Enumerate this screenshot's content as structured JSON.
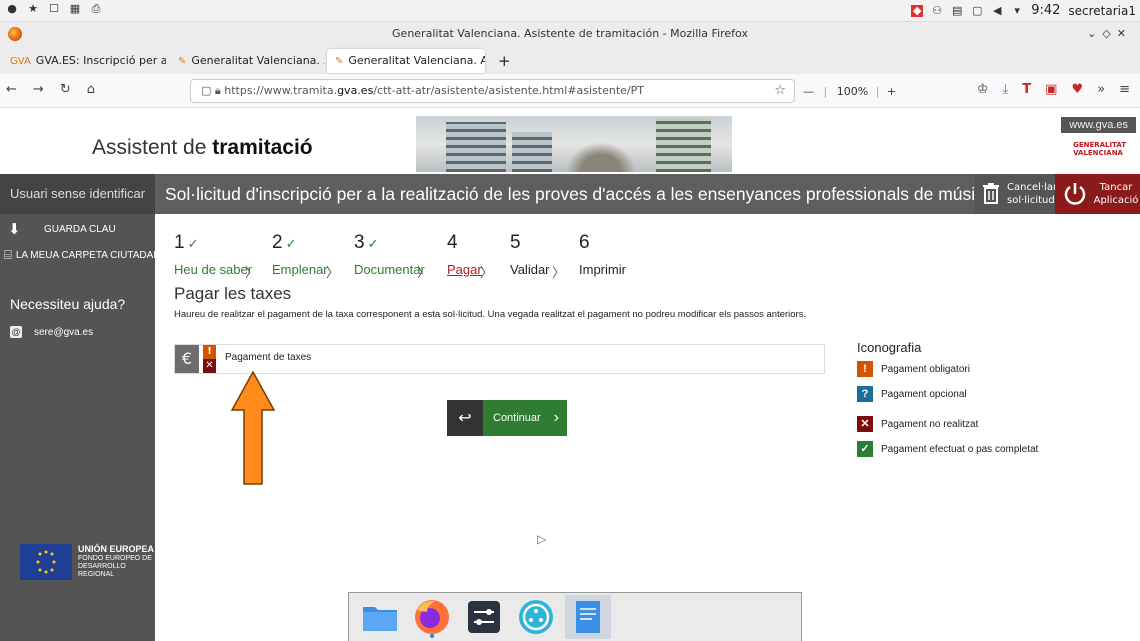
{
  "os": {
    "clock": "9:42",
    "user": "secretaria1"
  },
  "window": {
    "title": "Generalitat Valenciana. Asistente de tramitación - Mozilla Firefox"
  },
  "tabs": [
    {
      "label": "GVA.ES: Inscripció per a la",
      "fav": "GVA"
    },
    {
      "label": "Generalitat Valenciana. Asi"
    },
    {
      "label": "Generalitat Valenciana. Asi"
    }
  ],
  "nav": {
    "url_pre": "https://www.tramita.",
    "url_bold": "gva.es",
    "url_post": "/ctt-att-atr/asistente/asistente.html#asistente/PT",
    "zoom": "100%"
  },
  "site": {
    "brand_pre": "Assistent de ",
    "brand_bold": "tramitació",
    "gva_url": "www.gva.es",
    "logo_line1": "GENERALITAT",
    "logo_line2": "VALENCIANA"
  },
  "titlebar": {
    "user": "Usuari sense identificar",
    "page_title": "Sol·licitud d'inscripció per a la realització de les proves d'accés a les ensenyances professionals de música i dansa",
    "cancel_line1": "Cancel·lar",
    "cancel_line2": "sol·licitud",
    "close_line1": "Tancar",
    "close_line2": "Aplicació"
  },
  "sidebar": {
    "save_key": "GUARDA CLAU",
    "folder": "LA MEUA CARPETA CIUTADANA",
    "help": "Necessiteu ajuda?",
    "email": "sere@gva.es",
    "eu_title": "UNIÓN EUROPEA",
    "eu_line1": "FONDO EUROPEO DE",
    "eu_line2": "DESARROLLO REGIONAL"
  },
  "steps": [
    {
      "num": "1",
      "label": "Heu de saber",
      "state": "done"
    },
    {
      "num": "2",
      "label": "Emplenar",
      "state": "done"
    },
    {
      "num": "3",
      "label": "Documentar",
      "state": "done"
    },
    {
      "num": "4",
      "label": "Pagar",
      "state": "current"
    },
    {
      "num": "5",
      "label": "Validar",
      "state": "todo"
    },
    {
      "num": "6",
      "label": "Imprimir",
      "state": "todo"
    }
  ],
  "section": {
    "title": "Pagar les taxes",
    "description": "Haureu de realitzar el pagament de la taxa corresponent a esta sol·licitud. Una vegada realitzat el pagament no podreu modificar els passos anteriors.",
    "payment_label": "Pagament de taxes",
    "continue_label": "Continuar"
  },
  "iconography": {
    "title": "Iconografia",
    "items": [
      {
        "label": "Pagament obligatori",
        "symbol": "!",
        "color": "#d35400"
      },
      {
        "label": "Pagament opcional",
        "symbol": "?",
        "color": "#1b6f9a"
      },
      {
        "label": "Pagament no realitzat",
        "symbol": "✕",
        "color": "#7b0d0d"
      },
      {
        "label": "Pagament efectuat o pas completat",
        "symbol": "✓",
        "color": "#2e7d32"
      }
    ]
  },
  "colors": {
    "accent_green": "#2e7d32",
    "current_red": "#b71c1c",
    "arrow_orange": "#ff8c1a"
  }
}
